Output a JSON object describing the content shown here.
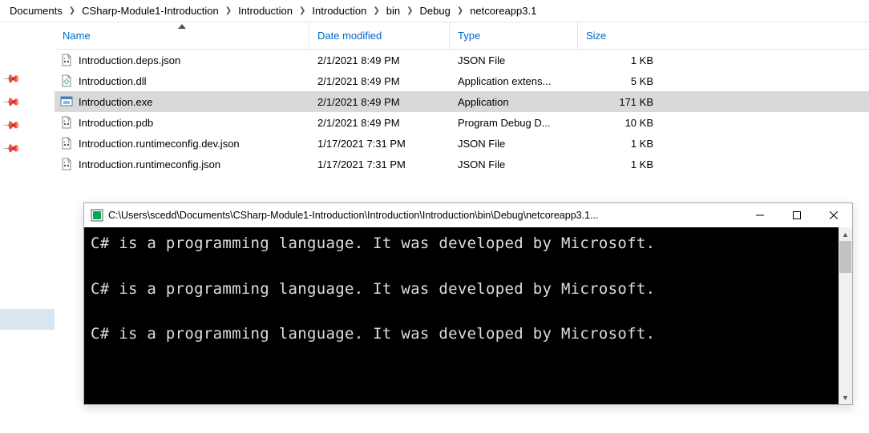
{
  "breadcrumb": [
    "Documents",
    "CSharp-Module1-Introduction",
    "Introduction",
    "Introduction",
    "bin",
    "Debug",
    "netcoreapp3.1"
  ],
  "columns": {
    "name": "Name",
    "date": "Date modified",
    "type": "Type",
    "size": "Size"
  },
  "files": [
    {
      "icon": "json",
      "name": "Introduction.deps.json",
      "date": "2/1/2021 8:49 PM",
      "type": "JSON File",
      "size": "1 KB",
      "selected": false
    },
    {
      "icon": "dll",
      "name": "Introduction.dll",
      "date": "2/1/2021 8:49 PM",
      "type": "Application extens...",
      "size": "5 KB",
      "selected": false
    },
    {
      "icon": "exe",
      "name": "Introduction.exe",
      "date": "2/1/2021 8:49 PM",
      "type": "Application",
      "size": "171 KB",
      "selected": true
    },
    {
      "icon": "pdb",
      "name": "Introduction.pdb",
      "date": "2/1/2021 8:49 PM",
      "type": "Program Debug D...",
      "size": "10 KB",
      "selected": false
    },
    {
      "icon": "json",
      "name": "Introduction.runtimeconfig.dev.json",
      "date": "1/17/2021 7:31 PM",
      "type": "JSON File",
      "size": "1 KB",
      "selected": false
    },
    {
      "icon": "json",
      "name": "Introduction.runtimeconfig.json",
      "date": "1/17/2021 7:31 PM",
      "type": "JSON File",
      "size": "1 KB",
      "selected": false
    }
  ],
  "console": {
    "title": "C:\\Users\\scedd\\Documents\\CSharp-Module1-Introduction\\Introduction\\Introduction\\bin\\Debug\\netcoreapp3.1...",
    "lines": [
      "C# is a programming language. It was developed by Microsoft.",
      "C# is a programming language. It was developed by Microsoft.",
      "C# is a programming language. It was developed by Microsoft."
    ]
  }
}
